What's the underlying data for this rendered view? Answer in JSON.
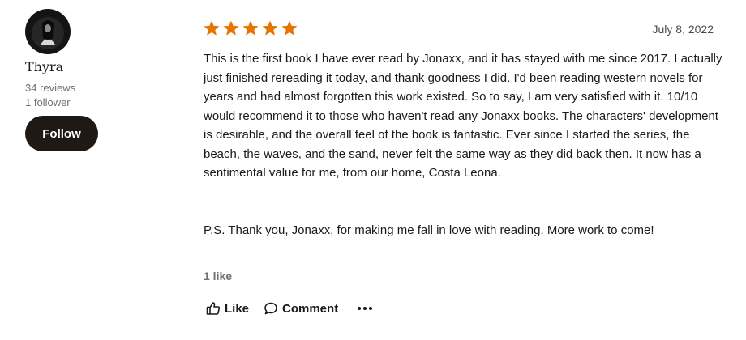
{
  "reviewer": {
    "avatar_icon": "profile-photo",
    "name": "Thyra",
    "reviews_count": "34 reviews",
    "followers": "1 follower",
    "follow_label": "Follow"
  },
  "review": {
    "rating": 5,
    "rating_max": 5,
    "star_color": "#e87400",
    "date": "July 8, 2022",
    "body_paragraph_1": "This is the first book I have ever read by Jonaxx, and it has stayed with me since 2017. I actually just finished rereading it today, and thank goodness I did. I'd been reading western novels for years and had almost forgotten this work existed. So to say, I am very satisfied with it. 10/10 would recommend it to those who haven't read any Jonaxx books. The characters' development is desirable, and the overall feel of the book is fantastic. Ever since I started the series, the beach, the waves, and the sand, never felt the same way as they did back then. It now has a sentimental value for me, from our home, Costa Leona.",
    "body_paragraph_2": "P.S. Thank you, Jonaxx, for making me fall in love with reading. More work to come!",
    "likes": "1 like"
  },
  "actions": {
    "like_label": "Like",
    "like_icon": "thumbs-up-icon",
    "comment_label": "Comment",
    "comment_icon": "speech-bubble-icon",
    "more_icon": "more-options-icon"
  }
}
